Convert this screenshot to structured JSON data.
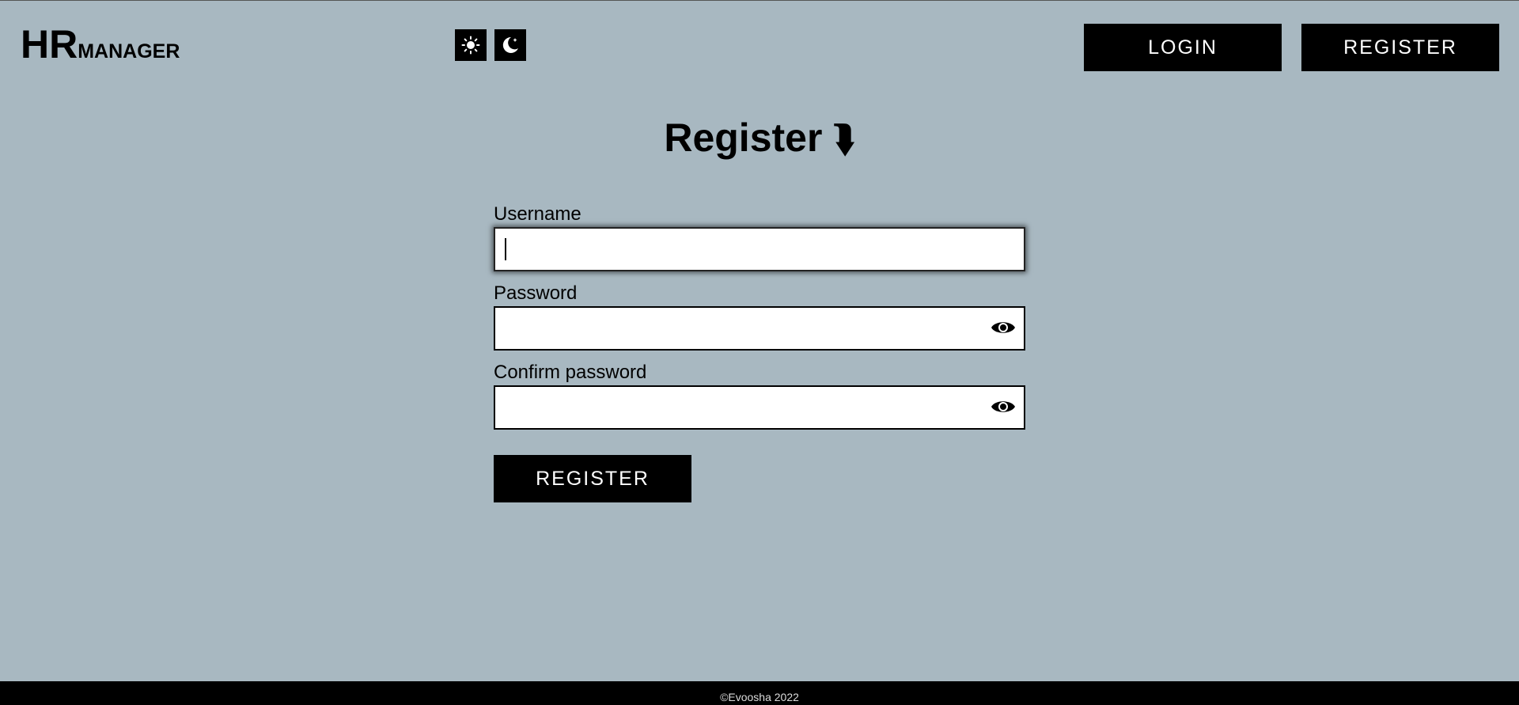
{
  "header": {
    "brand_primary": "HR",
    "brand_secondary": "MANAGER",
    "light_theme_icon": "sun-icon",
    "dark_theme_icon": "moon-icon",
    "login_label": "LOGIN",
    "register_label": "REGISTER"
  },
  "form": {
    "title": "Register",
    "title_icon": "arrow-down-icon",
    "title_arrow": "⮯",
    "username_label": "Username",
    "username_value": "",
    "password_label": "Password",
    "password_value": "",
    "confirm_label": "Confirm password",
    "confirm_value": "",
    "submit_label": "REGISTER"
  },
  "footer": {
    "copyright": "©Evoosha 2022"
  },
  "colors": {
    "background": "#a8b8c1",
    "button": "#000000",
    "button_text": "#ffffff"
  }
}
